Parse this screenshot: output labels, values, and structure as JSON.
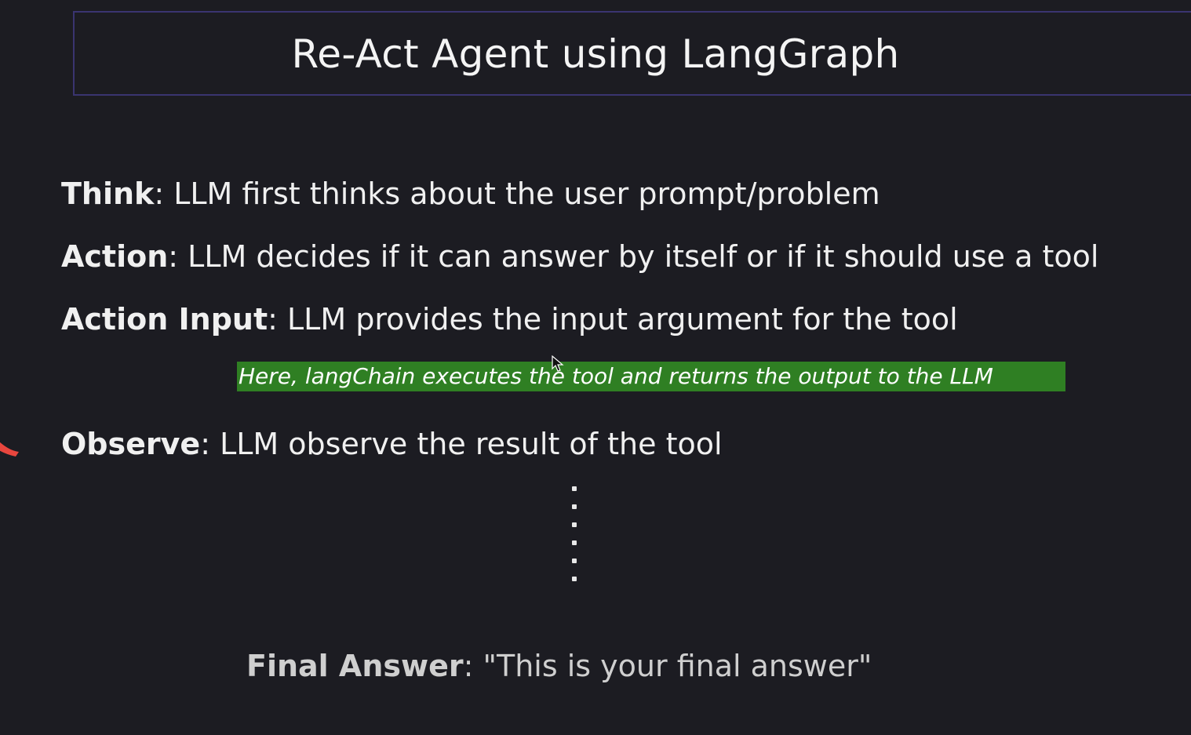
{
  "slide": {
    "title": "Re-Act Agent using LangGraph"
  },
  "steps": {
    "think": {
      "keyword": "Think",
      "text": ": LLM first thinks about the user prompt/problem"
    },
    "action": {
      "keyword": "Action",
      "text": ": LLM decides if it can answer by itself or if it should use a tool"
    },
    "action_input": {
      "keyword": "Action Input",
      "text": ": LLM provides the input argument for the tool"
    },
    "observe": {
      "keyword": "Observe",
      "text": ": LLM observe the result of the tool"
    }
  },
  "note": {
    "text": "Here, langChain executes the tool and returns the output to the LLM",
    "highlight_color": "#2f7f23"
  },
  "final": {
    "keyword": "Final Answer",
    "text": ": \"This is your final answer\""
  },
  "colors": {
    "background": "#1c1c22",
    "title_border": "#3a3470",
    "accent_arrow": "#e8463e"
  },
  "icons": {
    "ellipsis": "vertical-dots-icon",
    "cursor": "mouse-pointer-icon"
  }
}
